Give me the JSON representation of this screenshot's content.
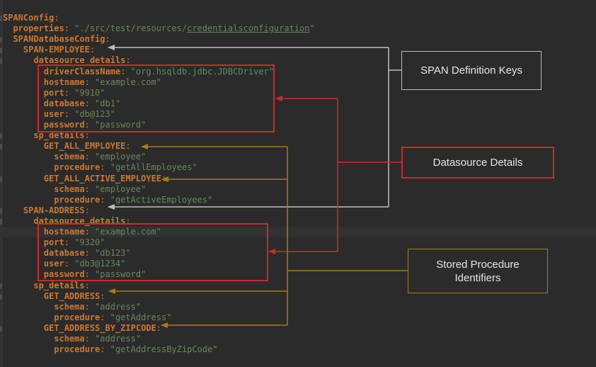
{
  "code_lines": [
    [
      {
        "t": "SPANConfig",
        "c": "k"
      },
      {
        "t": ":",
        "c": "p"
      }
    ],
    [
      {
        "t": "  "
      },
      {
        "t": "properties",
        "c": "k"
      },
      {
        "t": ": ",
        "c": "p"
      },
      {
        "t": "\"./src/test/resources/",
        "c": "s"
      },
      {
        "t": "credentialsconfiguration",
        "c": "s u"
      },
      {
        "t": "\"",
        "c": "s"
      }
    ],
    [
      {
        "t": "  "
      },
      {
        "t": "SPANDatabaseConfig",
        "c": "k"
      },
      {
        "t": ":",
        "c": "p"
      }
    ],
    [
      {
        "t": "    "
      },
      {
        "t": "SPAN-EMPLOYEE",
        "c": "k"
      },
      {
        "t": ":",
        "c": "p"
      }
    ],
    [
      {
        "t": "      "
      },
      {
        "t": "datasource_details",
        "c": "k"
      },
      {
        "t": ":",
        "c": "p"
      }
    ],
    [
      {
        "t": "        "
      },
      {
        "t": "driverClassName",
        "c": "k"
      },
      {
        "t": ": ",
        "c": "p"
      },
      {
        "t": "\"org.hsqldb.jdbc.JDBCDriver\"",
        "c": "s"
      }
    ],
    [
      {
        "t": "        "
      },
      {
        "t": "hostname",
        "c": "k"
      },
      {
        "t": ": ",
        "c": "p"
      },
      {
        "t": "\"example.com\"",
        "c": "s"
      }
    ],
    [
      {
        "t": "        "
      },
      {
        "t": "port",
        "c": "k"
      },
      {
        "t": ": ",
        "c": "p"
      },
      {
        "t": "\"9910\"",
        "c": "s"
      }
    ],
    [
      {
        "t": "        "
      },
      {
        "t": "database",
        "c": "k"
      },
      {
        "t": ": ",
        "c": "p"
      },
      {
        "t": "\"db1\"",
        "c": "s"
      }
    ],
    [
      {
        "t": "        "
      },
      {
        "t": "user",
        "c": "k"
      },
      {
        "t": ": ",
        "c": "p"
      },
      {
        "t": "\"db@123\"",
        "c": "s"
      }
    ],
    [
      {
        "t": "        "
      },
      {
        "t": "password",
        "c": "k"
      },
      {
        "t": ": ",
        "c": "p"
      },
      {
        "t": "\"password\"",
        "c": "s"
      }
    ],
    [
      {
        "t": "      "
      },
      {
        "t": "sp_details",
        "c": "k"
      },
      {
        "t": ":",
        "c": "p"
      }
    ],
    [
      {
        "t": "        "
      },
      {
        "t": "GET_ALL_EMPLOYEE",
        "c": "k"
      },
      {
        "t": ":",
        "c": "p"
      }
    ],
    [
      {
        "t": "          "
      },
      {
        "t": "schema",
        "c": "k"
      },
      {
        "t": ": ",
        "c": "p"
      },
      {
        "t": "\"employee\"",
        "c": "s"
      }
    ],
    [
      {
        "t": "          "
      },
      {
        "t": "procedure",
        "c": "k"
      },
      {
        "t": ": ",
        "c": "p"
      },
      {
        "t": "\"getAllEmployees\"",
        "c": "s"
      }
    ],
    [
      {
        "t": "        "
      },
      {
        "t": "GET_ALL_ACTIVE_EMPLOYEE",
        "c": "k"
      },
      {
        "t": ":",
        "c": "p"
      }
    ],
    [
      {
        "t": "          "
      },
      {
        "t": "schema",
        "c": "k"
      },
      {
        "t": ": ",
        "c": "p"
      },
      {
        "t": "\"employee\"",
        "c": "s"
      }
    ],
    [
      {
        "t": "          "
      },
      {
        "t": "procedure",
        "c": "k"
      },
      {
        "t": ": ",
        "c": "p"
      },
      {
        "t": "\"getActiveEmployees\"",
        "c": "s"
      }
    ],
    [
      {
        "t": "    "
      },
      {
        "t": "SPAN-ADDRESS",
        "c": "k"
      },
      {
        "t": ":",
        "c": "p"
      }
    ],
    [
      {
        "t": "      "
      },
      {
        "t": "datasource_details",
        "c": "k"
      },
      {
        "t": ":",
        "c": "p"
      }
    ],
    [
      {
        "t": "        "
      },
      {
        "t": "hostname",
        "c": "k"
      },
      {
        "t": ": ",
        "c": "p"
      },
      {
        "t": "\"example.com\"",
        "c": "s"
      }
    ],
    [
      {
        "t": "        "
      },
      {
        "t": "port",
        "c": "k"
      },
      {
        "t": ": ",
        "c": "p"
      },
      {
        "t": "\"9320\"",
        "c": "s"
      }
    ],
    [
      {
        "t": "        "
      },
      {
        "t": "database",
        "c": "k"
      },
      {
        "t": ": ",
        "c": "p"
      },
      {
        "t": "\"db123\"",
        "c": "s"
      }
    ],
    [
      {
        "t": "        "
      },
      {
        "t": "user",
        "c": "k"
      },
      {
        "t": ": ",
        "c": "p"
      },
      {
        "t": "\"db3@1234\"",
        "c": "s"
      }
    ],
    [
      {
        "t": "        "
      },
      {
        "t": "password",
        "c": "k"
      },
      {
        "t": ": ",
        "c": "p"
      },
      {
        "t": "\"password\"",
        "c": "s"
      }
    ],
    [
      {
        "t": "      "
      },
      {
        "t": "sp_details",
        "c": "k"
      },
      {
        "t": ":",
        "c": "p"
      }
    ],
    [
      {
        "t": "        "
      },
      {
        "t": "GET_ADDRESS",
        "c": "k"
      },
      {
        "t": ":",
        "c": "p"
      }
    ],
    [
      {
        "t": "          "
      },
      {
        "t": "schema",
        "c": "k"
      },
      {
        "t": ": ",
        "c": "p"
      },
      {
        "t": "\"address\"",
        "c": "s"
      }
    ],
    [
      {
        "t": "          "
      },
      {
        "t": "procedure",
        "c": "k"
      },
      {
        "t": ": ",
        "c": "p"
      },
      {
        "t": "\"getAddress\"",
        "c": "s"
      }
    ],
    [
      {
        "t": "        "
      },
      {
        "t": "GET_ADDRESS_BY_ZIPCODE",
        "c": "k"
      },
      {
        "t": ":",
        "c": "p"
      }
    ],
    [
      {
        "t": "          "
      },
      {
        "t": "schema",
        "c": "k"
      },
      {
        "t": ": ",
        "c": "p"
      },
      {
        "t": "\"address\"",
        "c": "s"
      }
    ],
    [
      {
        "t": "          "
      },
      {
        "t": "procedure",
        "c": "k"
      },
      {
        "t": ": ",
        "c": "p"
      },
      {
        "t": "\"getAddressByZipCode\"",
        "c": "s"
      }
    ]
  ],
  "highlighted_line_index": 20,
  "callouts": {
    "span_keys": "SPAN Definition Keys",
    "datasource": "Datasource Details",
    "stored_procedure_line1": "Stored Procedure",
    "stored_procedure_line2": "Identifiers"
  },
  "colors": {
    "background": "#2b2b2b",
    "span_keys_arrow": "#bfbfbf",
    "datasource_arrow": "#cf2a2a",
    "stored_procedure_arrow": "#a47d14",
    "yaml_key": "#cc7832",
    "yaml_string": "#6a8759"
  }
}
